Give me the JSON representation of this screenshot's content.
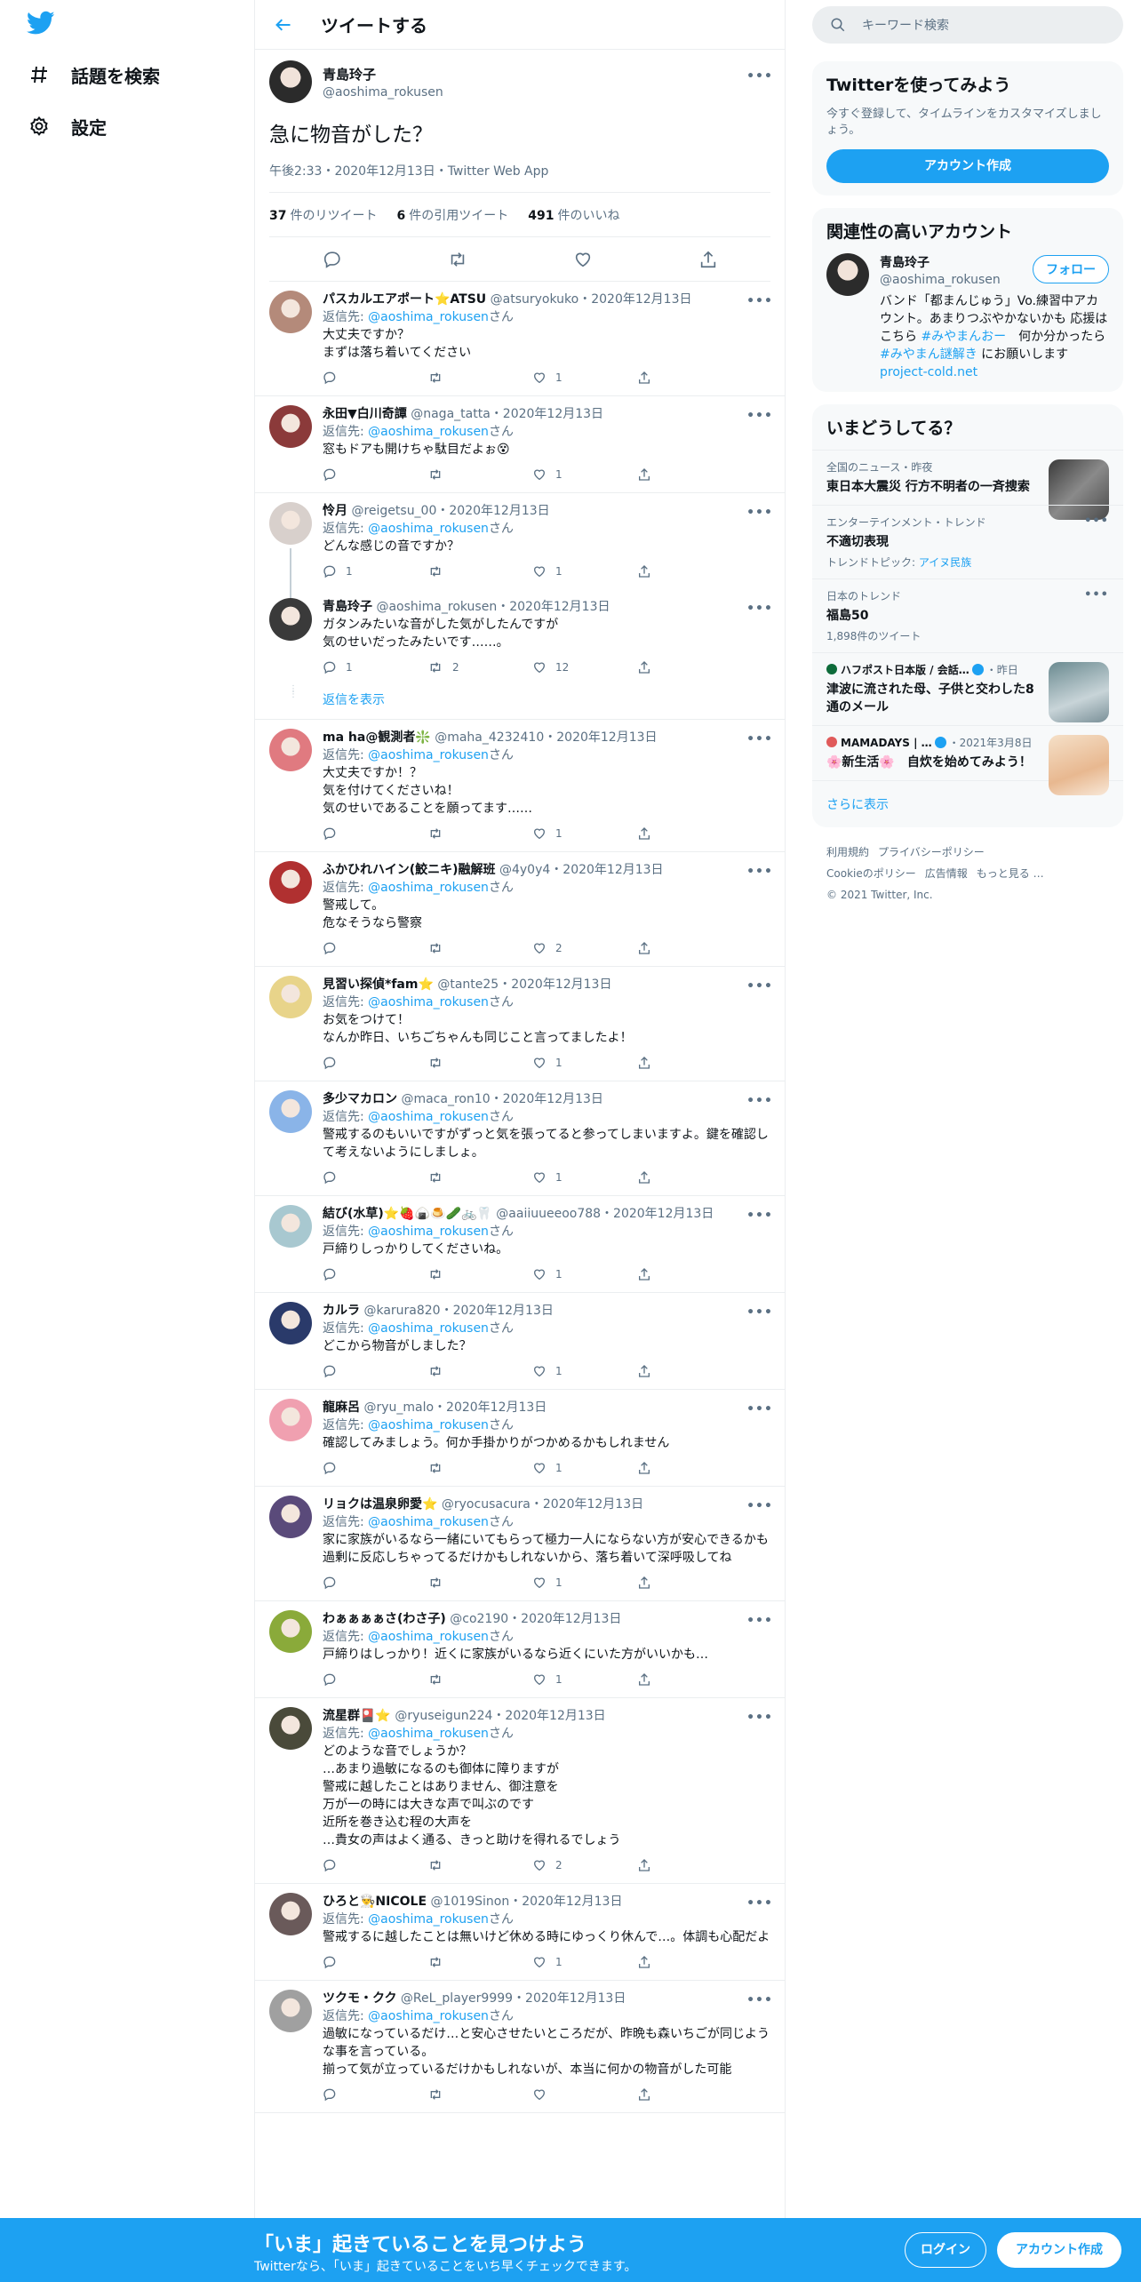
{
  "nav": {
    "explore_label": "話題を検索",
    "settings_label": "設定"
  },
  "header": {
    "title": "ツイートする"
  },
  "focus_tweet": {
    "display_name": "青島玲子",
    "username": "@aoshima_rokusen",
    "text": "急に物音がした？",
    "meta": "午後2:33・2020年12月13日・Twitter Web App",
    "retweets_count": "37",
    "retweets_label": "件のリツイート",
    "quotes_count": "6",
    "quotes_label": "件の引用ツイート",
    "likes_count": "491",
    "likes_label": "件のいいね"
  },
  "reply_to_prefix": "返信先: ",
  "reply_to_user": "@aoshima_rokusen",
  "reply_to_suffix": "さん",
  "show_replies": "返信を表示",
  "replies": [
    {
      "name": "パスカルエアポート⭐ATSU",
      "user": "@atsuryokuko",
      "date": "・2020年12月13日",
      "text": "大丈夫ですか？\nまずは落ち着いてください",
      "replies": "",
      "retweets": "",
      "likes": "1",
      "reply_to": true,
      "color": "#b48a7a"
    },
    {
      "name": "永田▼白川奇譚",
      "user": "@naga_tatta",
      "date": "・2020年12月13日",
      "text": "窓もドアも開けちゃ駄目だよぉ😵",
      "replies": "",
      "retweets": "",
      "likes": "1",
      "reply_to": true,
      "color": "#8b3a3a"
    },
    {
      "name": "怜月",
      "user": "@reigetsu_00",
      "date": "・2020年12月13日",
      "text": "どんな感じの音ですか？",
      "replies": "1",
      "retweets": "",
      "likes": "1",
      "reply_to": true,
      "color": "#d8d0cc"
    },
    {
      "name": "青島玲子",
      "user": "@aoshima_rokusen",
      "date": "・2020年12月13日",
      "text": "ガタンみたいな音がした気がしたんですが\n気のせいだったみたいです……。",
      "replies": "1",
      "retweets": "2",
      "likes": "12",
      "reply_to": false,
      "color": "#3a3a3a"
    },
    {
      "name": "ma ha@観測者❇️",
      "user": "@maha_4232410",
      "date": "・2020年12月13日",
      "text": "大丈夫ですか！？\n気を付けてくださいね！\n気のせいであることを願ってます……",
      "replies": "",
      "retweets": "",
      "likes": "1",
      "reply_to": true,
      "color": "#e07a80"
    },
    {
      "name": "ふかひれハイン(鮫ニキ)融解班",
      "user": "@4y0y4",
      "date": "・2020年12月13日",
      "text": "警戒して。\n危なそうなら警察",
      "replies": "",
      "retweets": "",
      "likes": "2",
      "reply_to": true,
      "color": "#b03030"
    },
    {
      "name": "見習い探偵*fam⭐",
      "user": "@tante25",
      "date": "・2020年12月13日",
      "text": "お気をつけて！\nなんか昨日、いちごちゃんも同じこと言ってましたよ！",
      "replies": "",
      "retweets": "",
      "likes": "1",
      "reply_to": true,
      "color": "#e8d48a"
    },
    {
      "name": "多少マカロン",
      "user": "@maca_ron10",
      "date": "・2020年12月13日",
      "text": "警戒するのもいいですがずっと気を張ってると参ってしまいますよ。鍵を確認して考えないようにしましょ。",
      "replies": "",
      "retweets": "",
      "likes": "1",
      "reply_to": true,
      "color": "#8ab4e8"
    },
    {
      "name": "結び(水草)⭐🍓🍙🍮🥒🚲🦷",
      "user": "@aaiiuueeoo788",
      "date": "・2020年12月13日",
      "text": "戸締りしっかりしてくださいね。",
      "replies": "",
      "retweets": "",
      "likes": "1",
      "reply_to": true,
      "color": "#a8c8d0"
    },
    {
      "name": "カルラ",
      "user": "@karura820",
      "date": "・2020年12月13日",
      "text": "どこから物音がしました？",
      "replies": "",
      "retweets": "",
      "likes": "1",
      "reply_to": true,
      "color": "#2a3a6a"
    },
    {
      "name": "龍麻呂",
      "user": "@ryu_malo",
      "date": "・2020年12月13日",
      "text": "確認してみましょう。何か手掛かりがつかめるかもしれません",
      "replies": "",
      "retweets": "",
      "likes": "1",
      "reply_to": true,
      "color": "#f0a0b0"
    },
    {
      "name": "リョクは温泉卵愛⭐",
      "user": "@ryocusacura",
      "date": "・2020年12月13日",
      "text": "家に家族がいるなら一緒にいてもらって極力一人にならない方が安心できるかも\n過剰に反応しちゃってるだけかもしれないから、落ち着いて深呼吸してね",
      "replies": "",
      "retweets": "",
      "likes": "1",
      "reply_to": true,
      "color": "#5a4a7a"
    },
    {
      "name": "わぁぁぁぁさ(わさ子)",
      "user": "@co2190",
      "date": "・2020年12月13日",
      "text": "戸締りはしっかり！近くに家族がいるなら近くにいた方がいいかも…",
      "replies": "",
      "retweets": "",
      "likes": "1",
      "reply_to": true,
      "color": "#8aaa3a"
    },
    {
      "name": "流星群🎴⭐",
      "user": "@ryuseigun224",
      "date": "・2020年12月13日",
      "text": "どのような音でしょうか？\n…あまり過敏になるのも御体に障りますが\n警戒に越したことはありません、御注意を\n万が一の時には大きな声で叫ぶのです\n近所を巻き込む程の大声を\n…貴女の声はよく通る、きっと助けを得れるでしょう",
      "replies": "",
      "retweets": "",
      "likes": "2",
      "reply_to": true,
      "color": "#4a4a3a"
    },
    {
      "name": "ひろと👨‍🍳NICOLE",
      "user": "@1019Sinon",
      "date": "・2020年12月13日",
      "text": "警戒するに越したことは無いけど休める時にゆっくり休んで…。体調も心配だよ",
      "replies": "",
      "retweets": "",
      "likes": "1",
      "reply_to": true,
      "color": "#6a5a5a"
    },
    {
      "name": "ツクモ・クク",
      "user": "@ReL_player9999",
      "date": "・2020年12月13日",
      "text": "過敏になっているだけ…と安心させたいところだが、昨晩も森いちごが同じような事を言っている。\n揃って気が立っているだけかもしれないが、本当に何かの物音がした可能",
      "replies": "",
      "retweets": "",
      "likes": "",
      "reply_to": true,
      "color": "#a0a0a0"
    }
  ],
  "search": {
    "placeholder": "キーワード検索"
  },
  "signup_card": {
    "title": "Twitterを使ってみよう",
    "subtitle": "今すぐ登録して、タイムラインをカスタマイズしましょう。",
    "button": "アカウント作成"
  },
  "related": {
    "title": "関連性の高いアカウント",
    "display_name": "青島玲子",
    "username": "@aoshima_rokusen",
    "follow": "フォロー",
    "bio_1": "バンド「都まんじゅう」Vo.練習中アカウント。あまりつぶやかないかも 応援はこちら ",
    "bio_tag1": "#みやまんおー",
    "bio_2": "　何か分かったら ",
    "bio_tag2": "#みやまん謎解き",
    "bio_3": " にお願いします　",
    "bio_link": "project-cold.net"
  },
  "trends": {
    "title": "いまどうしてる？",
    "items": [
      {
        "cat": "全国のニュース・昨夜",
        "name": "東日本大震災 行方不明者の一斉捜索",
        "sub": "",
        "thumb": "#5a5a5a"
      },
      {
        "cat": "エンターテインメント・トレンド",
        "name": "不適切表現",
        "sub_prefix": "トレンドトピック: ",
        "sub_link": "アイヌ民族"
      },
      {
        "cat": "日本のトレンド",
        "name": "福島50",
        "sub": "1,898件のツイート"
      },
      {
        "cat": "ハフポスト日本版 / 会話…",
        "cat_suffix": "・昨日",
        "name": "津波に流された母、子供と交わした8通のメール",
        "thumb": "#8aa0a8"
      },
      {
        "cat": "MAMADAYS | …",
        "cat_suffix": "・2021年3月8日",
        "name": "🌸新生活🌸　自炊を始めてみよう！",
        "thumb": "#f0c8a0"
      }
    ],
    "show_more": "さらに表示"
  },
  "footer": {
    "terms": "利用規約",
    "privacy": "プライバシーポリシー",
    "cookie": "Cookieのポリシー",
    "ads": "広告情報",
    "more": "もっと見る …",
    "copyright": "© 2021 Twitter, Inc."
  },
  "banner": {
    "headline": "「いま」起きていることを見つけよう",
    "sub": "Twitterなら、「いま」起きていることをいち早くチェックできます。",
    "login": "ログイン",
    "signup": "アカウント作成"
  },
  "colors": {
    "accent": "#1da1f2",
    "muted": "#5b7083",
    "border": "#ebeef0"
  }
}
